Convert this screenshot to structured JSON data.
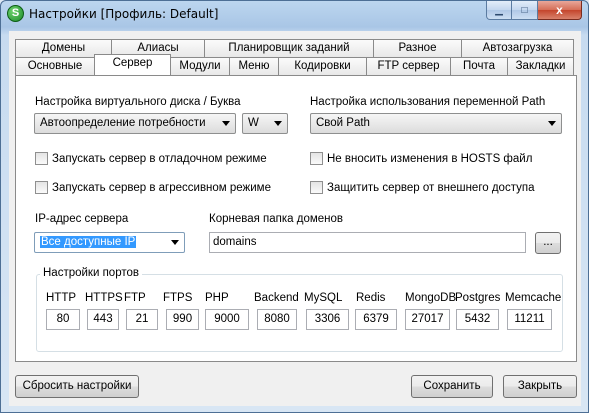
{
  "window": {
    "app_icon_letter": "S",
    "title": "Настройки [Профиль: Default]",
    "close_glyph": "x"
  },
  "tabs": {
    "row1": [
      "Домены",
      "Алиасы",
      "Планировщик заданий",
      "Разное",
      "Автозагрузка"
    ],
    "row2": [
      "Основные",
      "Сервер",
      "Модули",
      "Меню",
      "Кодировки",
      "FTP сервер",
      "Почта",
      "Закладки"
    ],
    "active": "Сервер"
  },
  "server": {
    "vdisk_label": "Настройка виртуального диска / Буква",
    "vdisk_value": "Автоопределение потребности",
    "drive_letter": "W",
    "path_label": "Настройка использования переменной Path",
    "path_value": "Свой Path",
    "checkboxes": {
      "debug": "Запускать сервер в отладочном режиме",
      "aggressive": "Запускать сервер в агрессивном режиме",
      "hosts": "Не вносить изменения в HOSTS файл",
      "protect": "Защитить сервер от внешнего доступа"
    },
    "ip_label": "IP-адрес сервера",
    "ip_value": "Все доступные IP",
    "root_label": "Корневая папка доменов",
    "root_value": "domains",
    "browse_label": "...",
    "ports_title": "Настройки портов",
    "ports": [
      {
        "name": "HTTP",
        "value": "80"
      },
      {
        "name": "HTTPS",
        "value": "443"
      },
      {
        "name": "FTP",
        "value": "21"
      },
      {
        "name": "FTPS",
        "value": "990"
      },
      {
        "name": "PHP",
        "value": "9000"
      },
      {
        "name": "Backend",
        "value": "8080"
      },
      {
        "name": "MySQL",
        "value": "3306"
      },
      {
        "name": "Redis",
        "value": "6379"
      },
      {
        "name": "MongoDB",
        "value": "27017"
      },
      {
        "name": "Postgres",
        "value": "5432"
      },
      {
        "name": "Memcache",
        "value": "11211"
      }
    ]
  },
  "footer": {
    "reset": "Сбросить настройки",
    "save": "Сохранить",
    "close": "Закрыть"
  }
}
